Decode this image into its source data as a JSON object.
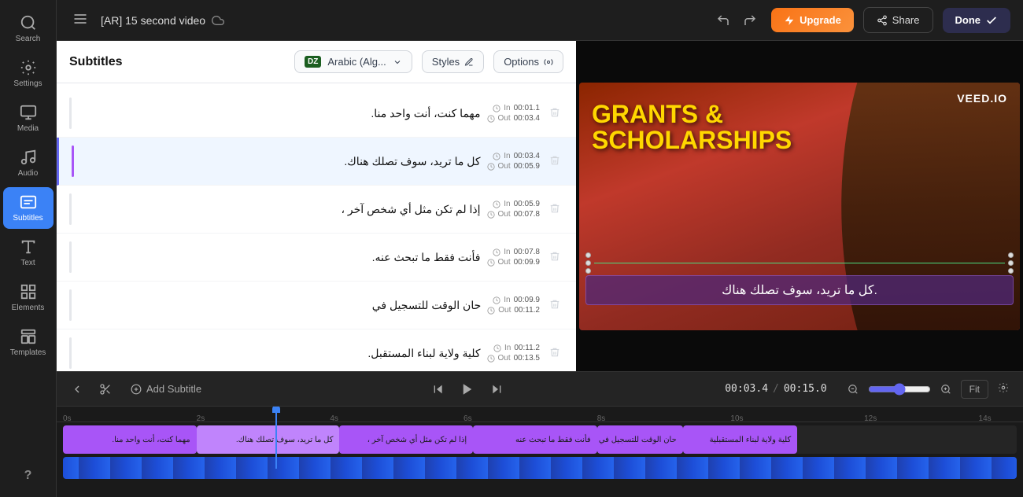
{
  "sidebar": {
    "items": [
      {
        "id": "search",
        "label": "Search",
        "icon": "search"
      },
      {
        "id": "settings",
        "label": "Settings",
        "icon": "settings"
      },
      {
        "id": "media",
        "label": "Media",
        "icon": "media"
      },
      {
        "id": "audio",
        "label": "Audio",
        "icon": "audio"
      },
      {
        "id": "subtitles",
        "label": "Subtitles",
        "icon": "subtitles",
        "active": true
      },
      {
        "id": "text",
        "label": "Text",
        "icon": "text"
      },
      {
        "id": "elements",
        "label": "Elements",
        "icon": "elements"
      },
      {
        "id": "templates",
        "label": "Templates",
        "icon": "templates"
      },
      {
        "id": "help",
        "label": "?",
        "icon": "help"
      }
    ]
  },
  "topbar": {
    "menu_icon": "☰",
    "video_title": "[AR] 15 second video",
    "upgrade_label": "Upgrade",
    "share_label": "Share",
    "done_label": "Done"
  },
  "subtitles_panel": {
    "title": "Subtitles",
    "language_flag": "DZ",
    "language_label": "Arabic (Alg...",
    "styles_label": "Styles",
    "options_label": "Options",
    "items": [
      {
        "id": 1,
        "text": "مهما كنت، أنت واحد منا.",
        "time_in": "00:01.1",
        "time_out": "00:03.4",
        "active": false,
        "purple_bar": false
      },
      {
        "id": 2,
        "text": "كل ما تريد، سوف تصلك هناك.",
        "time_in": "00:03.4",
        "time_out": "00:05.9",
        "active": true,
        "purple_bar": true
      },
      {
        "id": 3,
        "text": "إذا لم تكن مثل أي شخص آخر ،",
        "time_in": "00:05.9",
        "time_out": "00:07.8",
        "active": false,
        "purple_bar": false
      },
      {
        "id": 4,
        "text": "فأنت فقط ما تبحث عنه.",
        "time_in": "00:07.8",
        "time_out": "00:09.9",
        "active": false,
        "purple_bar": false
      },
      {
        "id": 5,
        "text": "حان الوقت للتسجيل في",
        "time_in": "00:09.9",
        "time_out": "00:11.2",
        "active": false,
        "purple_bar": false
      },
      {
        "id": 6,
        "text": "كلية ولاية لبناء المستقبل.",
        "time_in": "00:11.2",
        "time_out": "00:13.5",
        "active": false,
        "purple_bar": false
      }
    ]
  },
  "video": {
    "title_line1": "GRANTS &",
    "title_line2": "SCHOLARSHIPS",
    "subtitle_text": "كل ما تريد، سوف تصلك هناك.",
    "logo": "VEED.IO"
  },
  "timeline": {
    "current_time": "00:03.4",
    "total_time": "00:15.0",
    "fit_label": "Fit",
    "add_subtitle_label": "Add Subtitle",
    "ruler_marks": [
      "0s",
      "2s",
      "4s",
      "6s",
      "8s",
      "10s",
      "12s",
      "14s"
    ],
    "clips": [
      {
        "text": "مهما كنت، أنت واحد منا.",
        "left_pct": 0,
        "width_pct": 14
      },
      {
        "text": "كل ما تريد، سوف تصلك هناك.",
        "left_pct": 14,
        "width_pct": 16
      },
      {
        "text": "إذا لم تكن مثل أي شخص آخر ،",
        "left_pct": 30,
        "width_pct": 13
      },
      {
        "text": "فأنت فقط ما تبحث عنه",
        "left_pct": 43,
        "width_pct": 14
      },
      {
        "text": "حان الوقت للتسجيل في",
        "left_pct": 57,
        "width_pct": 9
      },
      {
        "text": "كلية ولاية لبناء المستقبلية",
        "left_pct": 66,
        "width_pct": 12
      }
    ],
    "playhead_pct": 22
  }
}
